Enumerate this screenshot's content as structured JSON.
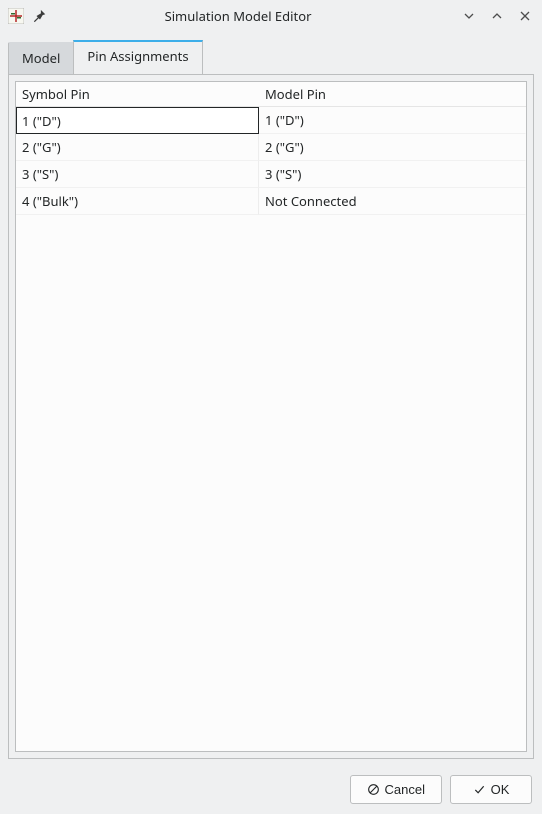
{
  "window": {
    "title": "Simulation Model Editor"
  },
  "tabs": {
    "model": "Model",
    "pin_assignments": "Pin Assignments"
  },
  "grid": {
    "headers": {
      "symbol_pin": "Symbol Pin",
      "model_pin": "Model Pin"
    },
    "rows": [
      {
        "symbol": "1 (\"D\")",
        "model": "1 (\"D\")"
      },
      {
        "symbol": "2 (\"G\")",
        "model": "2 (\"G\")"
      },
      {
        "symbol": "3 (\"S\")",
        "model": "3 (\"S\")"
      },
      {
        "symbol": "4 (\"Bulk\")",
        "model": "Not Connected"
      }
    ]
  },
  "buttons": {
    "cancel": "Cancel",
    "ok": "OK"
  }
}
